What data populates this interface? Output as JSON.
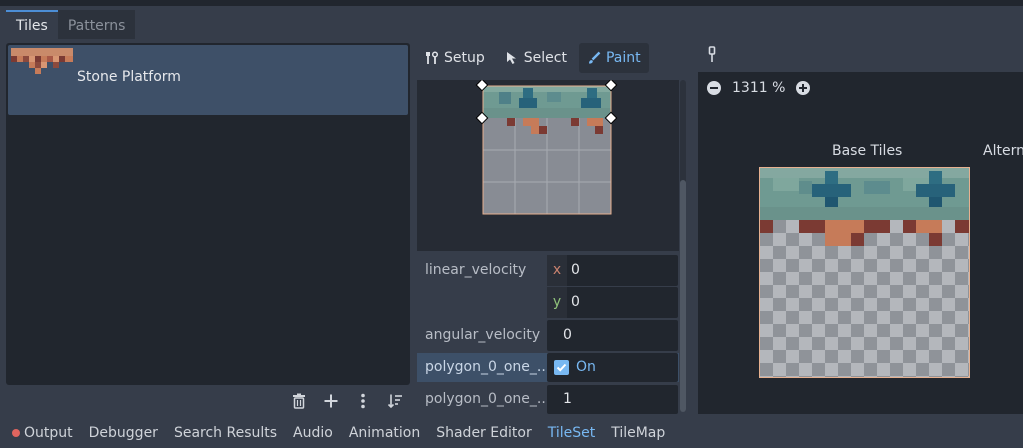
{
  "tabs": [
    {
      "label": "Tiles",
      "active": true
    },
    {
      "label": "Patterns",
      "active": false
    }
  ],
  "tile_list": {
    "items": [
      {
        "label": "Stone Platform",
        "selected": true
      }
    ]
  },
  "list_actions": [
    "trash-icon",
    "add-icon",
    "kebab-menu-icon",
    "sort-icon"
  ],
  "toolbar": {
    "setup_label": "Setup",
    "select_label": "Select",
    "paint_label": "Paint",
    "active": "Paint"
  },
  "properties": {
    "linear_velocity": {
      "label": "linear_velocity",
      "x_axis": "x",
      "x_value": "0",
      "y_axis": "y",
      "y_value": "0"
    },
    "angular_velocity": {
      "label": "angular_velocity",
      "value": "0"
    },
    "polygon_one_way": {
      "label": "polygon_0_one_...",
      "checked": true,
      "value_label": "On"
    },
    "polygon_one_way_margin": {
      "label": "polygon_0_one_...",
      "value": "1"
    }
  },
  "atlas_view": {
    "zoom": "1311 %",
    "base_tiles_title": "Base Tiles",
    "alternative_tiles_title": "Altern"
  },
  "bottom_bar": {
    "items": [
      {
        "label": "Output",
        "has_error_dot": true
      },
      {
        "label": "Debugger"
      },
      {
        "label": "Search Results"
      },
      {
        "label": "Audio"
      },
      {
        "label": "Animation"
      },
      {
        "label": "Shader Editor"
      },
      {
        "label": "TileSet",
        "active": true
      },
      {
        "label": "TileMap"
      }
    ]
  },
  "colors": {
    "accent": "#78b8f2",
    "selection": "#3e5068",
    "x_axis": "#c9826f",
    "y_axis": "#8fc27a",
    "error_dot": "#e0655f"
  }
}
